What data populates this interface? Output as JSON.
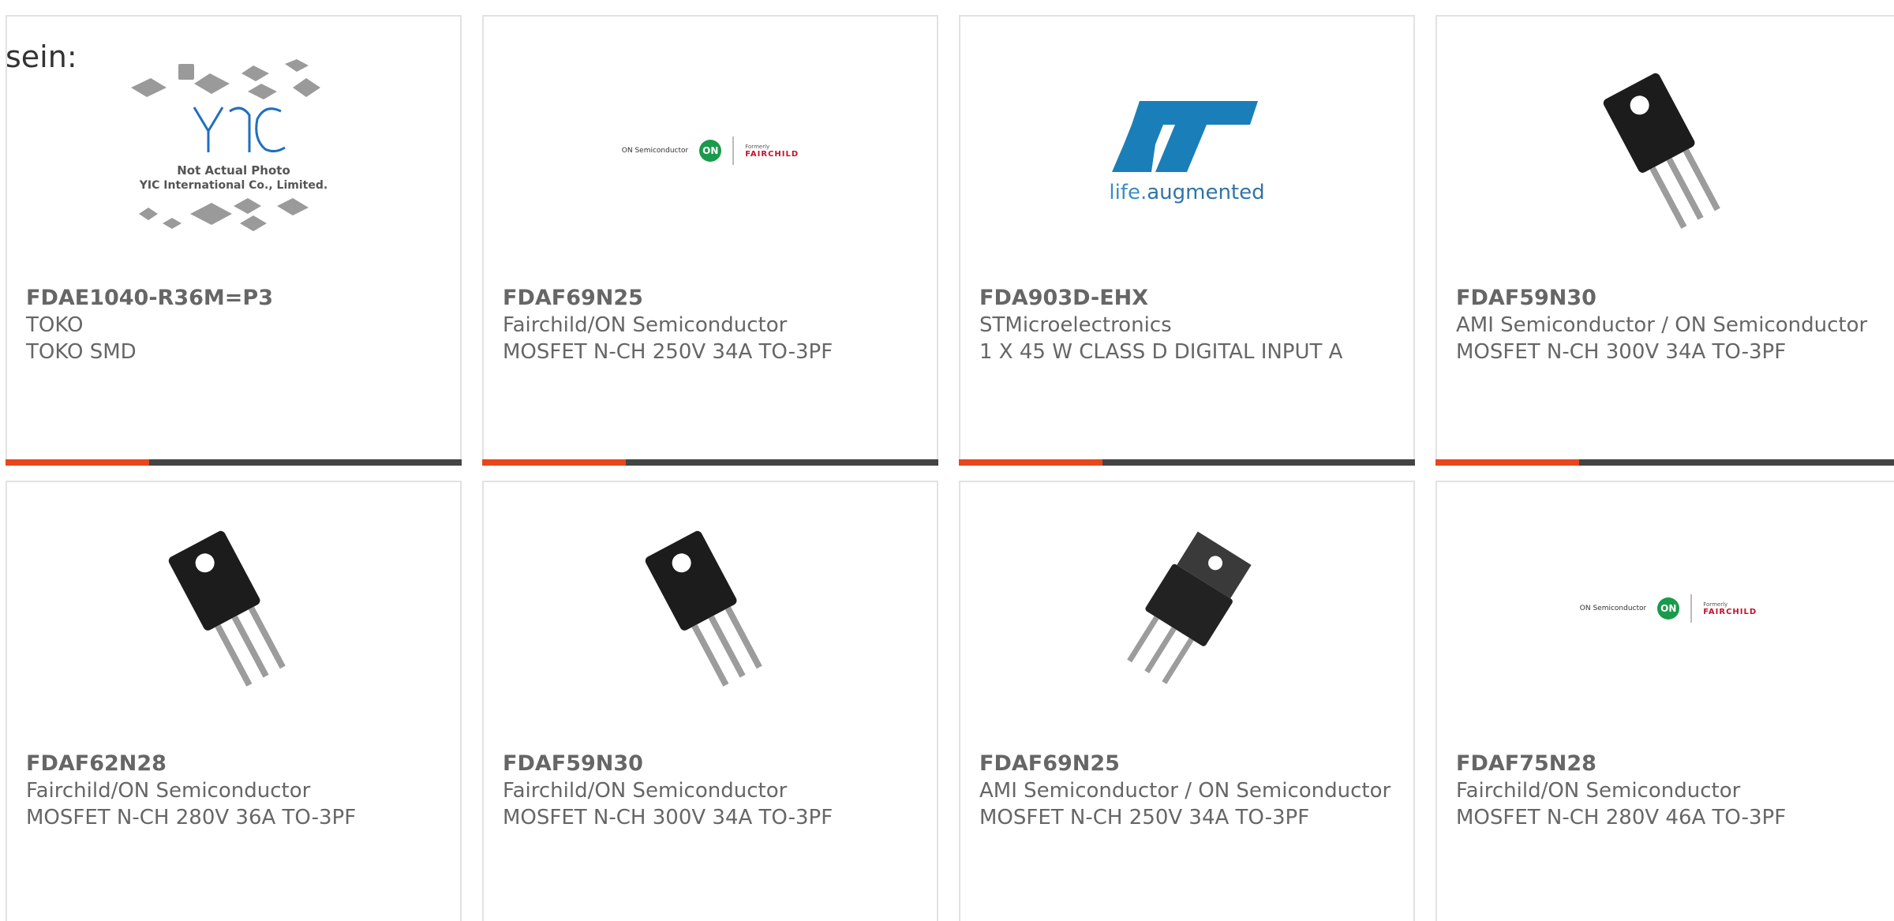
{
  "caption": "sein:",
  "colors": {
    "accent": "#e8471c",
    "bar": "#444444",
    "text": "#666666",
    "border": "#e2e2e2"
  },
  "products": [
    {
      "part_number": "FDAE1040-R36M=P3",
      "manufacturer": "TOKO",
      "description": "TOKO SMD",
      "image": "yic-placeholder",
      "image_text": {
        "brand": "YIC",
        "line1": "Not Actual Photo",
        "line2": "YIC International Co., Limited."
      }
    },
    {
      "part_number": "FDAF69N25",
      "manufacturer": "Fairchild/ON Semiconductor",
      "description": "MOSFET N-CH 250V 34A TO-3PF",
      "image": "on-fairchild-logo",
      "image_text": {
        "on_text": "ON Semiconductor",
        "on_mark": "ON",
        "formerly": "Formerly",
        "fairchild": "FAIRCHILD"
      }
    },
    {
      "part_number": "FDA903D-EHX",
      "manufacturer": "STMicroelectronics",
      "description": "1 X 45 W CLASS D DIGITAL INPUT A",
      "image": "st-logo",
      "image_text": {
        "tagline_a": "life.",
        "tagline_b": "augmented"
      }
    },
    {
      "part_number": "FDAF59N30",
      "manufacturer": "AMI Semiconductor / ON Semiconductor",
      "description": "MOSFET N-CH 300V 34A TO-3PF",
      "image": "to3pf-transistor"
    },
    {
      "part_number": "FDAF62N28",
      "manufacturer": "Fairchild/ON Semiconductor",
      "description": "MOSFET N-CH 280V 36A TO-3PF",
      "image": "to3pf-transistor"
    },
    {
      "part_number": "FDAF59N30",
      "manufacturer": "Fairchild/ON Semiconductor",
      "description": "MOSFET N-CH 300V 34A TO-3PF",
      "image": "to3pf-transistor"
    },
    {
      "part_number": "FDAF69N25",
      "manufacturer": "AMI Semiconductor / ON Semiconductor",
      "description": "MOSFET N-CH 250V 34A TO-3PF",
      "image": "to220-transistor"
    },
    {
      "part_number": "FDAF75N28",
      "manufacturer": "Fairchild/ON Semiconductor",
      "description": "MOSFET N-CH 280V 46A TO-3PF",
      "image": "on-fairchild-logo",
      "image_text": {
        "on_text": "ON Semiconductor",
        "on_mark": "ON",
        "formerly": "Formerly",
        "fairchild": "FAIRCHILD"
      }
    }
  ]
}
